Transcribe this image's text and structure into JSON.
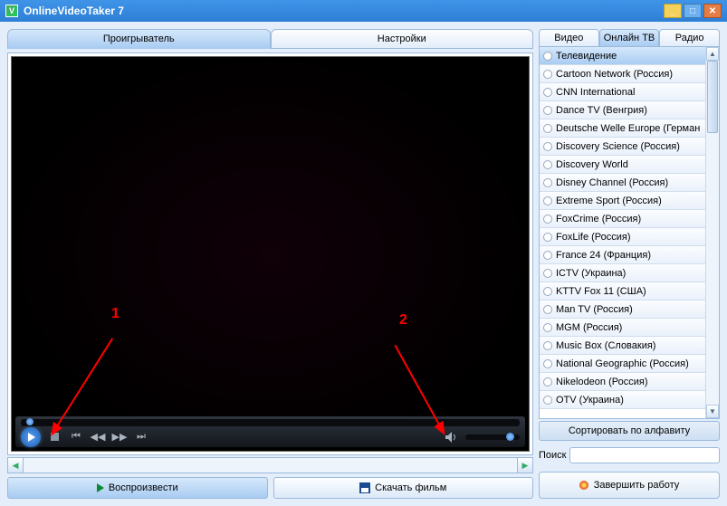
{
  "window": {
    "title": "OnlineVideoTaker 7"
  },
  "main_tabs": {
    "player": "Проигрыватель",
    "settings": "Настройки"
  },
  "side_tabs": {
    "video": "Видео",
    "online_tv": "Онлайн ТВ",
    "radio": "Радио"
  },
  "channels": [
    "Телевидение",
    "Cartoon Network (Россия)",
    "CNN International",
    "Dance TV (Венгрия)",
    "Deutsche Welle Europe (Герман",
    "Discovery Science (Россия)",
    "Discovery World",
    "Disney Channel (Россия)",
    "Extreme Sport (Россия)",
    "FoxCrime (Россия)",
    "FoxLife (Россия)",
    "France 24 (Франция)",
    "ICTV (Украина)",
    "KTTV Fox 11 (США)",
    "Man TV (Россия)",
    "MGM (Россия)",
    "Music Box (Словакия)",
    "National Geographic (Россия)",
    "Nikelodeon (Россия)",
    "OTV (Украина)"
  ],
  "buttons": {
    "sort": "Сортировать по алфавиту",
    "search_label": "Поиск",
    "exit": "Завершить работу",
    "play": "Воспроизвести",
    "download": "Скачать фильм"
  },
  "callouts": {
    "one": "1",
    "two": "2"
  }
}
